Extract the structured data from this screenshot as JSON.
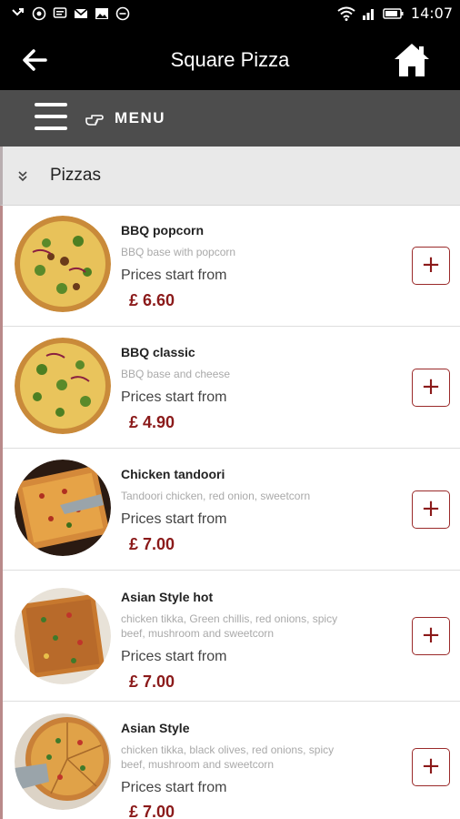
{
  "status_bar": {
    "time": "14:07"
  },
  "header": {
    "title": "Square Pizza",
    "back_icon": "arrow-left-icon",
    "home_icon": "home-icon"
  },
  "menu_bar": {
    "label": "MENU"
  },
  "category": {
    "label": "Pizzas"
  },
  "items": [
    {
      "name": "BBQ popcorn",
      "description": "BBQ base with popcorn",
      "price_label": "Prices start from",
      "price": "£ 6.60"
    },
    {
      "name": "BBQ classic",
      "description": "BBQ base and cheese",
      "price_label": "Prices start from",
      "price": "£ 4.90"
    },
    {
      "name": "Chicken tandoori",
      "description": "Tandoori chicken, red onion, sweetcorn",
      "price_label": "Prices start from",
      "price": "£ 7.00"
    },
    {
      "name": "Asian Style hot",
      "description": "chicken tikka, Green chillis, red onions, spicy beef, mushroom and sweetcorn",
      "price_label": "Prices start from",
      "price": "£ 7.00"
    },
    {
      "name": "Asian Style",
      "description": "chicken tikka, black olives, red onions, spicy beef, mushroom and sweetcorn",
      "price_label": "Prices start from",
      "price": "£ 7.00"
    }
  ],
  "add_button_label": "+",
  "colors": {
    "accent": "#8b1a1a",
    "header_bg": "#000000",
    "menu_bg": "#4d4d4d"
  }
}
